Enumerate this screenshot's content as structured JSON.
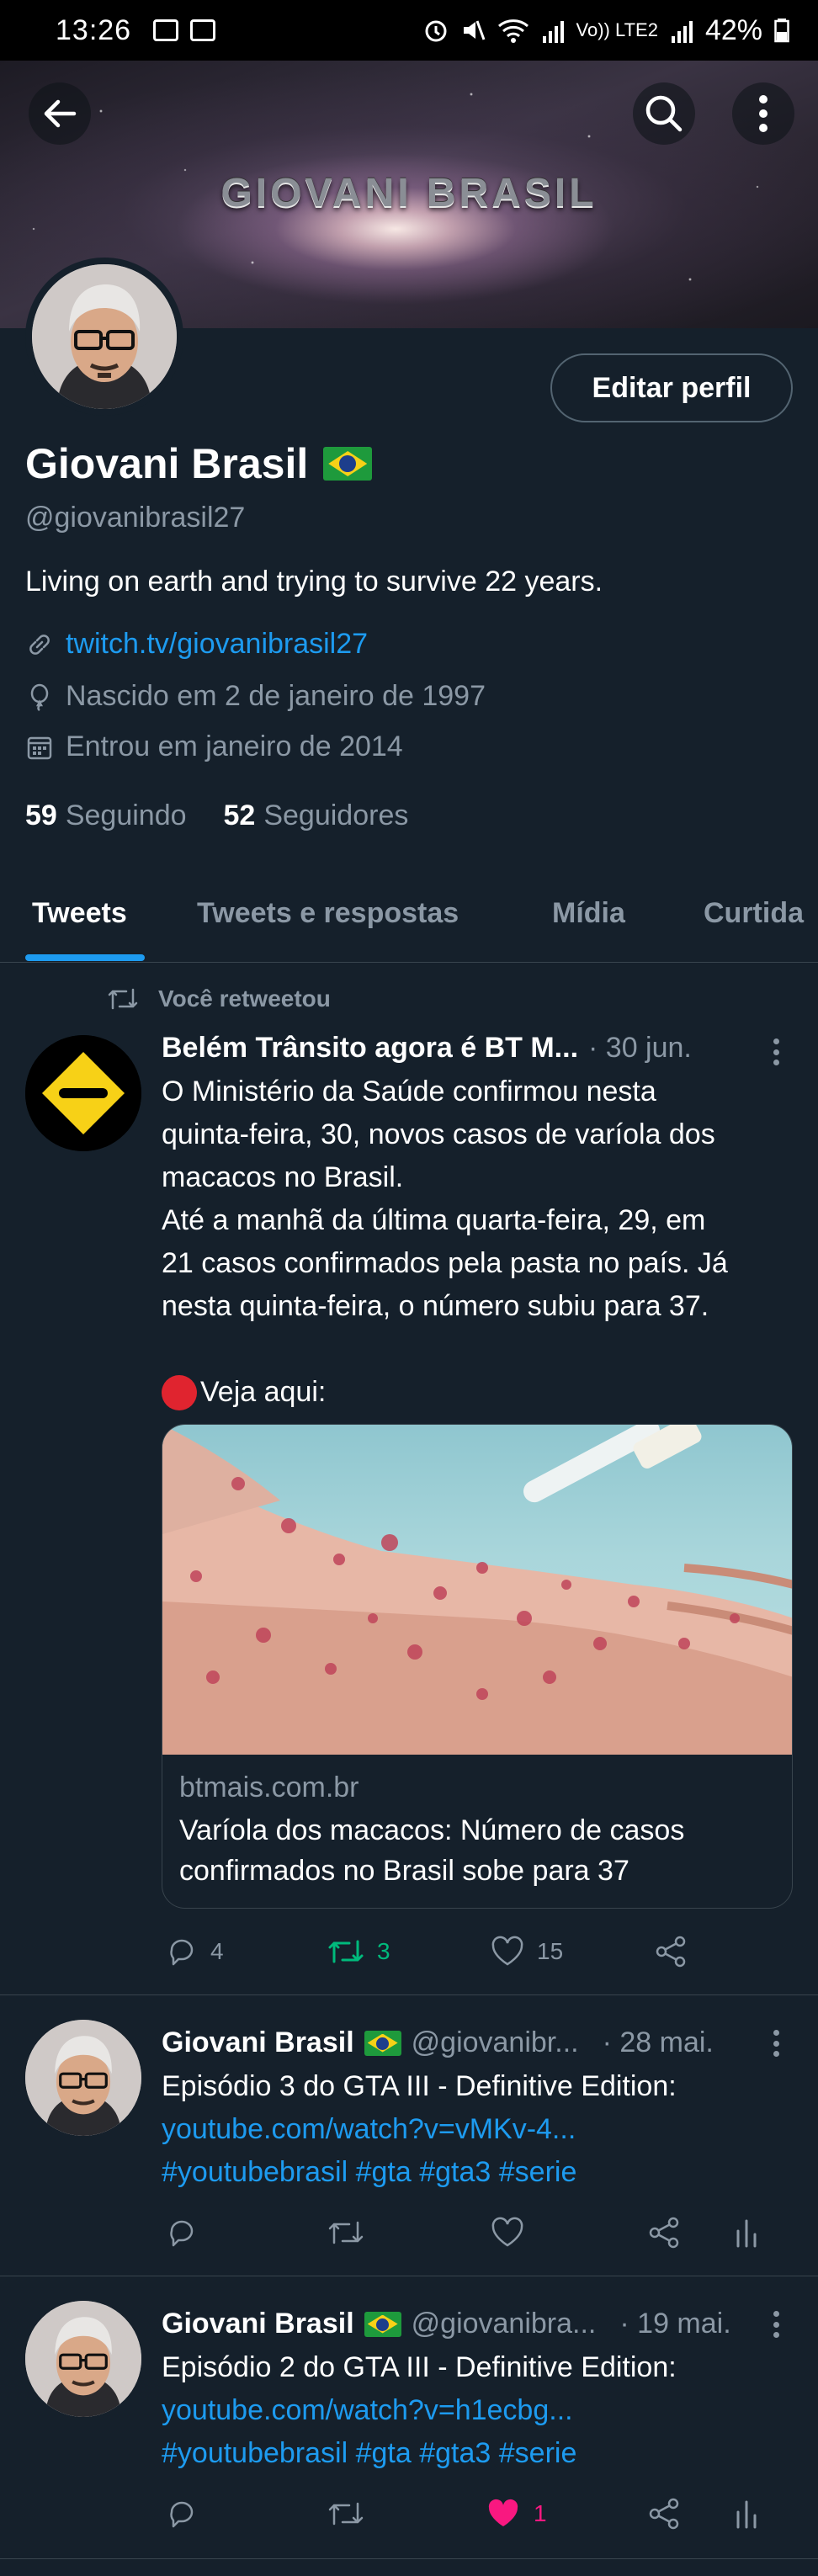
{
  "status_bar": {
    "time": "13:26",
    "battery": "42%",
    "network_small": "Vo)) LTE2"
  },
  "header": {
    "banner_title": "GIOVANI BRASIL"
  },
  "profile": {
    "name": "Giovani Brasil",
    "edit_label": "Editar perfil",
    "handle": "@giovanibrasil27",
    "bio": "Living on earth and trying to survive 22 years.",
    "link": "twitch.tv/giovanibrasil27",
    "birth": "Nascido em 2 de janeiro de 1997",
    "joined": "Entrou em janeiro de 2014",
    "following_count": "59",
    "following_label": "Seguindo",
    "followers_count": "52",
    "followers_label": "Seguidores"
  },
  "tabs": [
    "Tweets",
    "Tweets e respostas",
    "Mídia",
    "Curtida"
  ],
  "tweets": [
    {
      "retweet_label": "Você retweetou",
      "name": "Belém Trânsito agora é BT M...",
      "date": "· 30 jun.",
      "text_lines": [
        "O Ministério da Saúde confirmou nesta",
        "quinta-feira, 30, novos casos de varíola dos",
        "macacos no Brasil.",
        "Até a manhã da última quarta-feira, 29, em",
        "21 casos confirmados pela pasta no país. Já",
        "nesta quinta-feira, o número subiu para 37."
      ],
      "extra": "Veja aqui:",
      "card_domain": "btmais.com.br",
      "card_title": "Varíola dos macacos: Número de casos confirmados no Brasil sobe para 37",
      "replies": "4",
      "retweets": "3",
      "likes": "15"
    },
    {
      "name": "Giovani Brasil",
      "handle": "@giovanibr...",
      "date": "· 28 mai.",
      "text": "Episódio 3 do GTA III - Definitive Edition:",
      "link": "youtube.com/watch?v=vMKv-4...",
      "hashtags": "#youtubebrasil #gta #gta3 #serie"
    },
    {
      "name": "Giovani Brasil",
      "handle": "@giovanibra...",
      "date": "· 19 mai.",
      "text": "Episódio 2 do GTA III - Definitive Edition:",
      "link": "youtube.com/watch?v=h1ecbg...",
      "hashtags": "#youtubebrasil #gta #gta3 #serie",
      "likes": "1"
    }
  ],
  "colors": {
    "background": "#15202b",
    "accent": "#1d9bf0",
    "secondary_text": "#8b98a5",
    "retweet_green": "#00ba7c",
    "like_pink": "#f91880"
  }
}
